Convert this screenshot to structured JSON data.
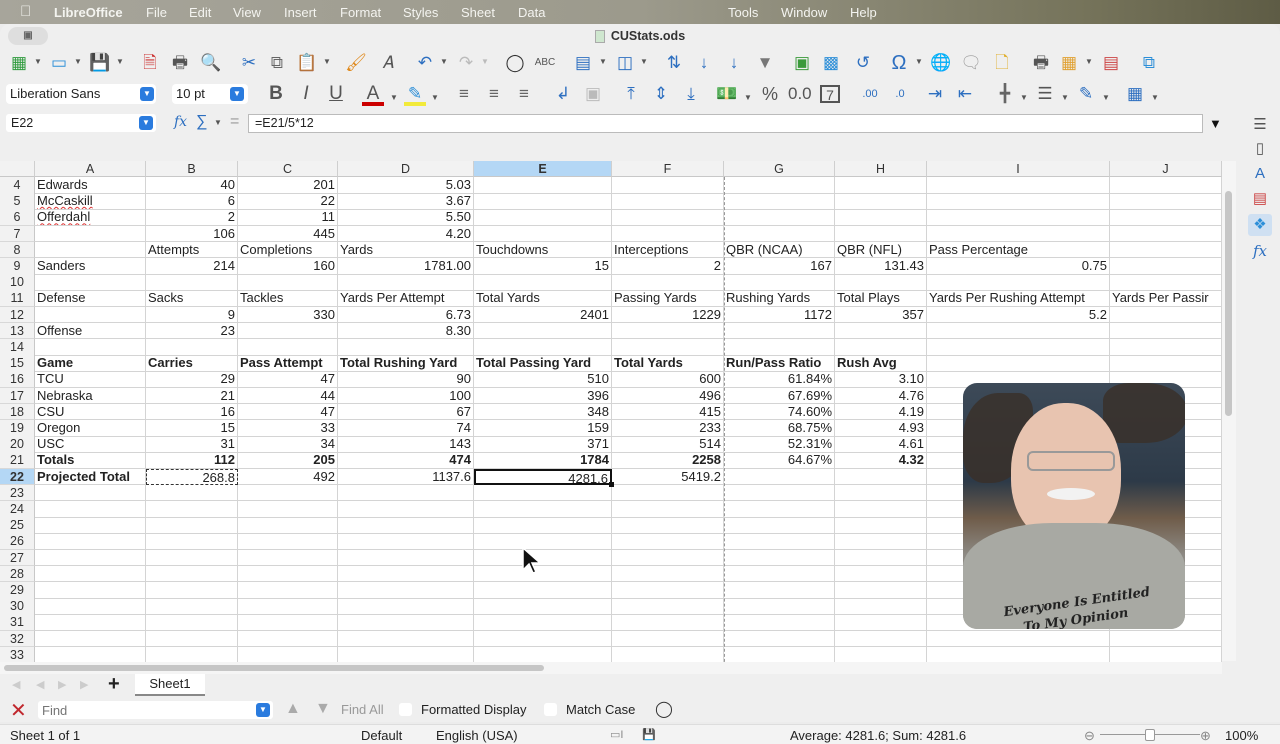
{
  "menubar": {
    "apple": "",
    "app_name": "LibreOffice",
    "items": [
      "File",
      "Edit",
      "View",
      "Insert",
      "Format",
      "Styles",
      "Sheet",
      "Data",
      "Tools",
      "Window",
      "Help"
    ]
  },
  "window": {
    "title": "CUStats.ods"
  },
  "toolbar1": {
    "icons": [
      "new-spreadsheet-icon",
      "open-folder-icon",
      "save-icon",
      "export-pdf-icon",
      "print-icon",
      "print-preview-icon",
      "cut-icon",
      "copy-icon",
      "paste-icon",
      "clone-formatting-icon",
      "clear-formatting-icon",
      "undo-icon",
      "redo-icon",
      "find-replace-icon",
      "spelling-icon",
      "row-icon",
      "column-icon",
      "sort-icon",
      "sort-ascending-icon",
      "sort-descending-icon",
      "autofilter-icon",
      "insert-image-icon",
      "insert-chart-icon",
      "pivot-table-icon",
      "special-character-icon",
      "hyperlink-icon",
      "comment-icon",
      "headers-footers-icon",
      "print-range-icon",
      "freeze-rows-icon",
      "split-window-icon",
      "show-draw-functions-icon"
    ]
  },
  "toolbar2": {
    "font_name": "Liberation Sans",
    "font_size": "10 pt"
  },
  "formula_bar": {
    "name_box": "E22",
    "formula": "=E21/5*12"
  },
  "columns": [
    "A",
    "B",
    "C",
    "D",
    "E",
    "F",
    "G",
    "H",
    "I",
    "J"
  ],
  "selected_column": "E",
  "selected_row": "22",
  "rows": [
    {
      "n": "4",
      "cells": {
        "A": "Edwards",
        "B": "40",
        "C": "201",
        "D": "5.03"
      }
    },
    {
      "n": "5",
      "cells": {
        "A": "McCaskill",
        "B": "6",
        "C": "22",
        "D": "3.67"
      }
    },
    {
      "n": "6",
      "cells": {
        "A": "Offerdahl",
        "B": "2",
        "C": "11",
        "D": "5.50"
      }
    },
    {
      "n": "7",
      "cells": {
        "B": "106",
        "C": "445",
        "D": "4.20"
      }
    },
    {
      "n": "8",
      "cells": {
        "B": "Attempts",
        "C": "Completions",
        "D": "Yards",
        "E": "Touchdowns",
        "F": "Interceptions",
        "G": "QBR (NCAA)",
        "H": "QBR (NFL)",
        "I": "Pass Percentage"
      }
    },
    {
      "n": "9",
      "cells": {
        "A": "Sanders",
        "B": "214",
        "C": "160",
        "D": "1781.00",
        "E": "15",
        "F": "2",
        "G": "167",
        "H": "131.43",
        "I": "0.75"
      }
    },
    {
      "n": "10",
      "cells": {}
    },
    {
      "n": "11",
      "cells": {
        "A": "Defense",
        "B": "Sacks",
        "C": "Tackles",
        "D": "Yards Per Attempt",
        "E": "Total Yards",
        "F": "Passing Yards",
        "G": "Rushing Yards",
        "H": "Total Plays",
        "I": "Yards Per Rushing Attempt",
        "J": "Yards Per Passir"
      }
    },
    {
      "n": "12",
      "cells": {
        "B": "9",
        "C": "330",
        "D": "6.73",
        "E": "2401",
        "F": "1229",
        "G": "1172",
        "H": "357",
        "I": "5.2"
      }
    },
    {
      "n": "13",
      "cells": {
        "A": "Offense",
        "B": "23",
        "D": "8.30"
      }
    },
    {
      "n": "14",
      "cells": {}
    },
    {
      "n": "15",
      "cells": {
        "A": "Game",
        "B": "Carries",
        "C": "Pass Attempt",
        "D": "Total Rushing Yard",
        "E": "Total Passing Yard",
        "F": "Total Yards",
        "G": "Run/Pass Ratio",
        "H": "Rush Avg"
      }
    },
    {
      "n": "16",
      "cells": {
        "A": "TCU",
        "B": "29",
        "C": "47",
        "D": "90",
        "E": "510",
        "F": "600",
        "G": "61.84%",
        "H": "3.10"
      }
    },
    {
      "n": "17",
      "cells": {
        "A": "Nebraska",
        "B": "21",
        "C": "44",
        "D": "100",
        "E": "396",
        "F": "496",
        "G": "67.69%",
        "H": "4.76"
      }
    },
    {
      "n": "18",
      "cells": {
        "A": "CSU",
        "B": "16",
        "C": "47",
        "D": "67",
        "E": "348",
        "F": "415",
        "G": "74.60%",
        "H": "4.19"
      }
    },
    {
      "n": "19",
      "cells": {
        "A": "Oregon",
        "B": "15",
        "C": "33",
        "D": "74",
        "E": "159",
        "F": "233",
        "G": "68.75%",
        "H": "4.93"
      }
    },
    {
      "n": "20",
      "cells": {
        "A": "USC",
        "B": "31",
        "C": "34",
        "D": "143",
        "E": "371",
        "F": "514",
        "G": "52.31%",
        "H": "4.61"
      }
    },
    {
      "n": "21",
      "cells": {
        "A": "Totals",
        "B": "112",
        "C": "205",
        "D": "474",
        "E": "1784",
        "F": "2258",
        "G": "64.67%",
        "H": "4.32"
      }
    },
    {
      "n": "22",
      "cells": {
        "A": "Projected Total",
        "B": "268.8",
        "C": "492",
        "D": "1137.6",
        "E": "4281.6",
        "F": "5419.2"
      }
    },
    {
      "n": "23",
      "cells": {}
    },
    {
      "n": "24",
      "cells": {}
    },
    {
      "n": "25",
      "cells": {}
    },
    {
      "n": "26",
      "cells": {}
    },
    {
      "n": "27",
      "cells": {}
    },
    {
      "n": "28",
      "cells": {}
    },
    {
      "n": "29",
      "cells": {}
    },
    {
      "n": "30",
      "cells": {}
    },
    {
      "n": "31",
      "cells": {}
    },
    {
      "n": "32",
      "cells": {}
    },
    {
      "n": "33",
      "cells": {}
    }
  ],
  "sheet_tabs": {
    "add_label": "+",
    "tabs": [
      "Sheet1"
    ]
  },
  "find_bar": {
    "placeholder": "Find",
    "find_all": "Find All",
    "formatted_display": "Formatted Display",
    "match_case": "Match Case"
  },
  "status_bar": {
    "sheet": "Sheet 1 of 1",
    "page_style": "Default",
    "language": "English (USA)",
    "selection_summary": "Average: 4281.6; Sum: 4281.6",
    "zoom": "100%",
    "zoom_level_percent": 100
  },
  "webcam": {
    "description": "Presenter webcam overlay",
    "shirt_text_line1": "Everyone Is Entitled",
    "shirt_text_line2": "To My Opinion"
  },
  "colors": {
    "selection_header": "#b4d7f5",
    "find_close": "#c0272d",
    "dropdown_accent": "#2a7bde"
  }
}
